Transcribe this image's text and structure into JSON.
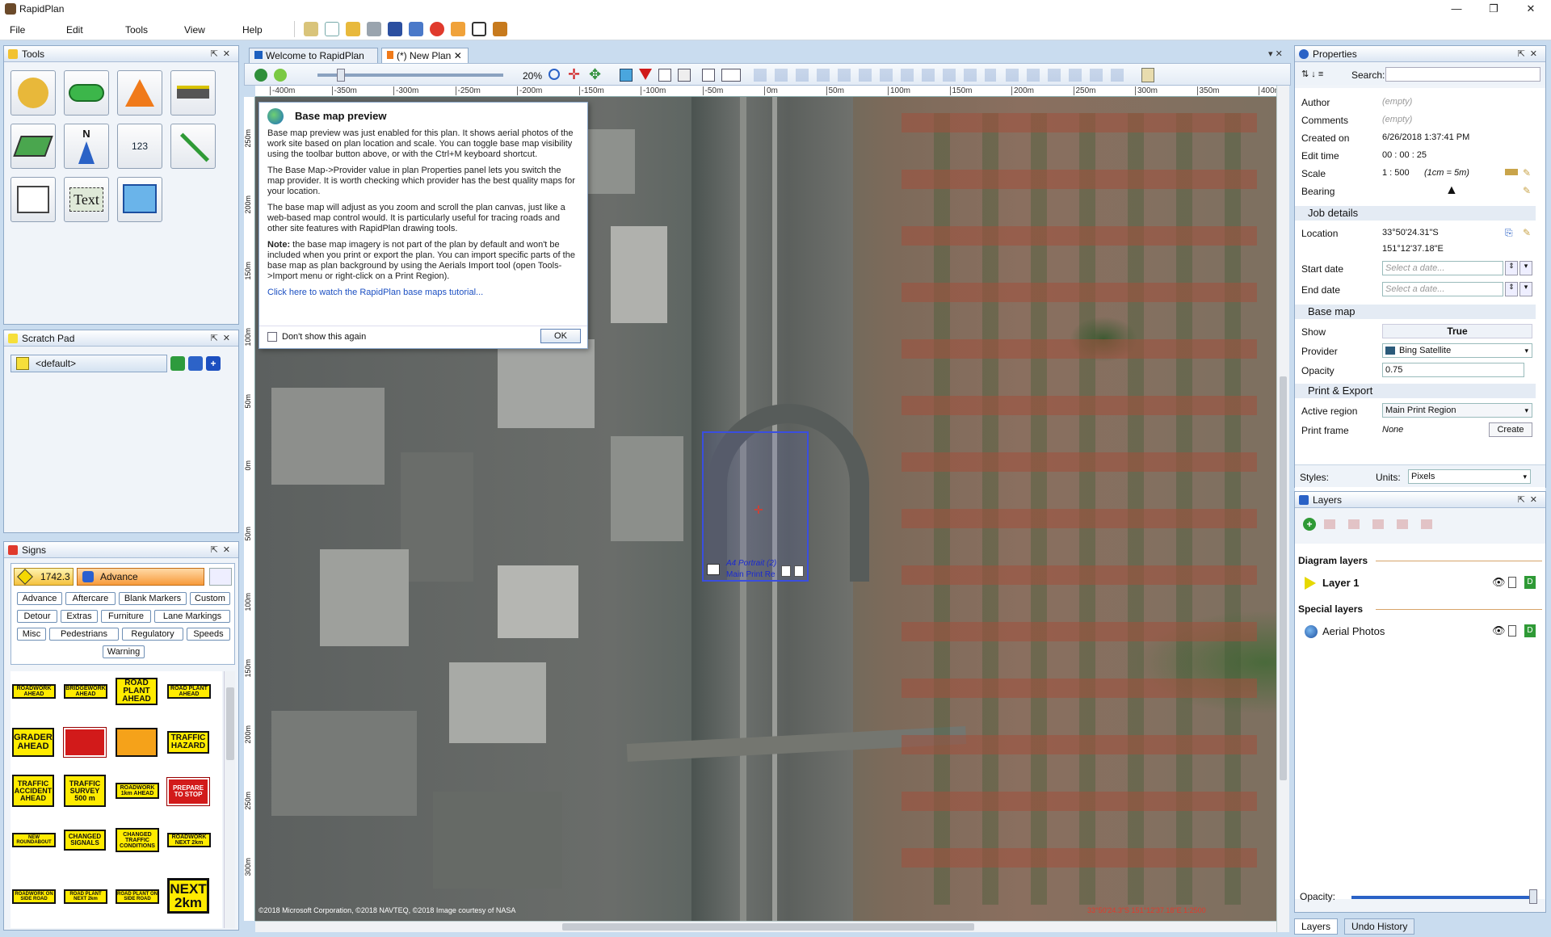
{
  "app": {
    "title": "RapidPlan"
  },
  "menu": [
    "File",
    "Edit",
    "Tools",
    "View",
    "Help"
  ],
  "panels": {
    "tools": "Tools",
    "scratch": "Scratch Pad",
    "signs": "Signs",
    "properties": "Properties",
    "layers": "Layers"
  },
  "tools": {
    "text_tool": "Text",
    "measure_tool": "123",
    "north_tool": "N"
  },
  "scratch": {
    "selected": "<default>"
  },
  "tabs": [
    {
      "label": "Welcome to RapidPlan"
    },
    {
      "label": "(*) New Plan"
    }
  ],
  "canvas_toolbar": {
    "zoom": "20%"
  },
  "ruler": [
    "-400m",
    "-350m",
    "-300m",
    "-250m",
    "-200m",
    "-150m",
    "-100m",
    "-50m",
    "0m",
    "50m",
    "100m",
    "150m",
    "200m",
    "250m",
    "300m",
    "350m",
    "400m"
  ],
  "vruler": [
    "250m",
    "200m",
    "150m",
    "100m",
    "50m",
    "0m",
    "50m",
    "100m",
    "150m",
    "200m",
    "250m",
    "300m"
  ],
  "dialog": {
    "title": "Base map preview",
    "p1": "Base map preview was just enabled for this plan. It shows aerial photos of the work site based on plan location and scale. You can toggle base map visibility using the toolbar button above, or with the Ctrl+M keyboard shortcut.",
    "p2": "The Base Map->Provider value in plan Properties panel lets you switch the map provider. It is worth checking which provider has the best quality maps for your location.",
    "p3": "The base map will adjust as you zoom and scroll the plan canvas, just like a web-based map control would. It is particularly useful for tracing roads and other site features with RapidPlan drawing tools.",
    "note_label": "Note:",
    "p4": " the base map imagery is not part of the plan by default and won't be included when you print or export the plan. You can import specific parts of the base map as plan background by using the Aerials Import tool (open Tools->Import menu or right-click on a Print Region).",
    "link": "Click here to watch the RapidPlan base maps tutorial...",
    "checkbox": "Don't show this again",
    "ok": "OK"
  },
  "print_region": {
    "line1": "A4 Portrait (2)",
    "line2": "Main Print Re"
  },
  "map_footer": {
    "copyright": "©2018 Microsoft Corporation, ©2018 NAVTEQ, ©2018 Image courtesy of NASA",
    "coords": "33°50'24.3\"S 151°12'37.18\"E   1:2500"
  },
  "signs": {
    "code": "1742.3",
    "selected_category": "Advance",
    "categories": [
      "Advance",
      "Aftercare",
      "Blank Markers",
      "Custom",
      "Detour",
      "Extras",
      "Furniture",
      "Lane Markings",
      "Misc",
      "Pedestrians",
      "Regulatory",
      "Speeds",
      "Warning"
    ],
    "sign_texts": [
      "ROADWORK AHEAD",
      "BRIDGEWORK AHEAD",
      "ROAD PLANT AHEAD",
      "ROAD PLANT AHEAD",
      "GRADER AHEAD",
      "",
      "",
      "TRAFFIC HAZARD",
      "TRAFFIC ACCIDENT AHEAD",
      "TRAFFIC SURVEY 500 m",
      "ROADWORK 1km AHEAD",
      "PREPARE TO STOP",
      "NEW ROUNDABOUT",
      "CHANGED SIGNALS",
      "CHANGED TRAFFIC CONDITIONS",
      "ROADWORK NEXT 2km",
      "ROADWORK ON SIDE ROAD",
      "ROAD PLANT NEXT 2km",
      "ROAD PLANT ON SIDE ROAD",
      "NEXT 2km"
    ]
  },
  "properties": {
    "search_label": "Search:",
    "author_k": "Author",
    "author_v": "(empty)",
    "comments_k": "Comments",
    "comments_v": "(empty)",
    "created_k": "Created on",
    "created_v": "6/26/2018 1:37:41 PM",
    "edit_k": "Edit time",
    "edit_v": "00 : 00 : 25",
    "scale_k": "Scale",
    "scale_v": "1 : 500",
    "scale_note": "(1cm = 5m)",
    "bearing_k": "Bearing",
    "job_section": "Job details",
    "location_k": "Location",
    "location_v1": "33°50'24.31\"S",
    "location_v2": "151°12'37.18\"E",
    "start_k": "Start date",
    "end_k": "End date",
    "date_placeholder": "Select a date...",
    "basemap_section": "Base map",
    "show_k": "Show",
    "show_v": "True",
    "provider_k": "Provider",
    "provider_v": "Bing Satellite",
    "opacity_k": "Opacity",
    "opacity_v": "0.75",
    "print_section": "Print & Export",
    "region_k": "Active region",
    "region_v": "Main Print Region",
    "frame_k": "Print frame",
    "frame_v": "None",
    "create": "Create",
    "styles_label": "Styles:",
    "units_label": "Units:",
    "units_v": "Pixels"
  },
  "layers": {
    "diagram_label": "Diagram layers",
    "layer1": "Layer 1",
    "special_label": "Special layers",
    "aerial": "Aerial Photos",
    "opacity_label": "Opacity:"
  },
  "bottom_tabs": [
    "Layers",
    "Undo History"
  ]
}
